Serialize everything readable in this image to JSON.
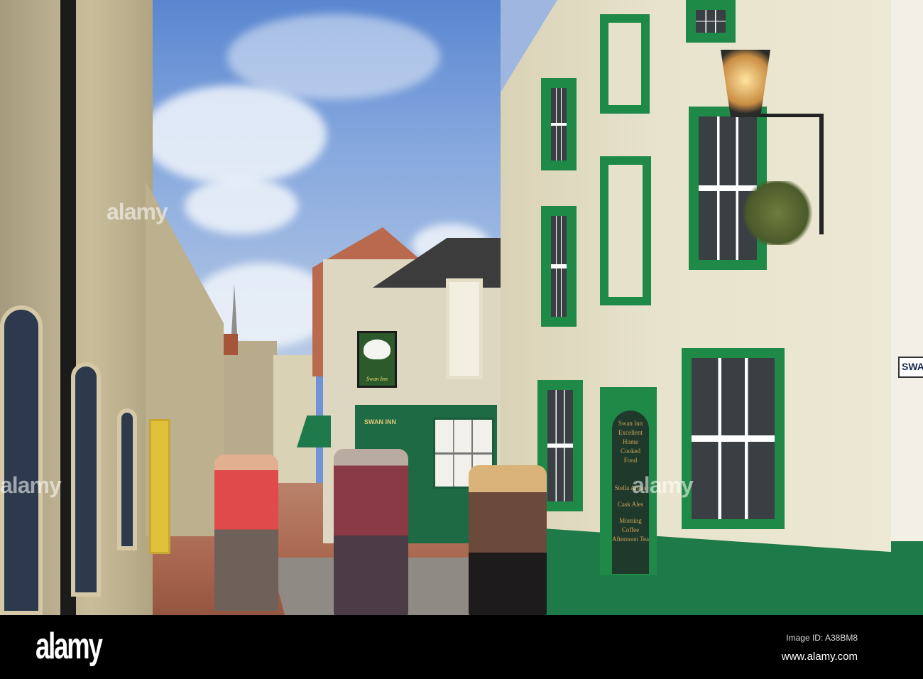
{
  "photo": {
    "description_signs": {
      "pub_sign": "Swan Inn",
      "fascia": "SWAN INN",
      "street_sign": "SWA",
      "door_board": [
        "Swan Inn",
        "Excellent",
        "Home Cooked",
        "Food",
        "Stella Artois",
        "Cask Ales",
        "Morning Coffee",
        "Afternoon Tea"
      ]
    }
  },
  "watermark": {
    "text": "alamy"
  },
  "footer": {
    "logo": "alamy",
    "image_id": "Image ID: A38BM8",
    "url": "www.alamy.com"
  },
  "colors": {
    "shop_green": "#1f8a48",
    "sky": "#6f93d4"
  }
}
